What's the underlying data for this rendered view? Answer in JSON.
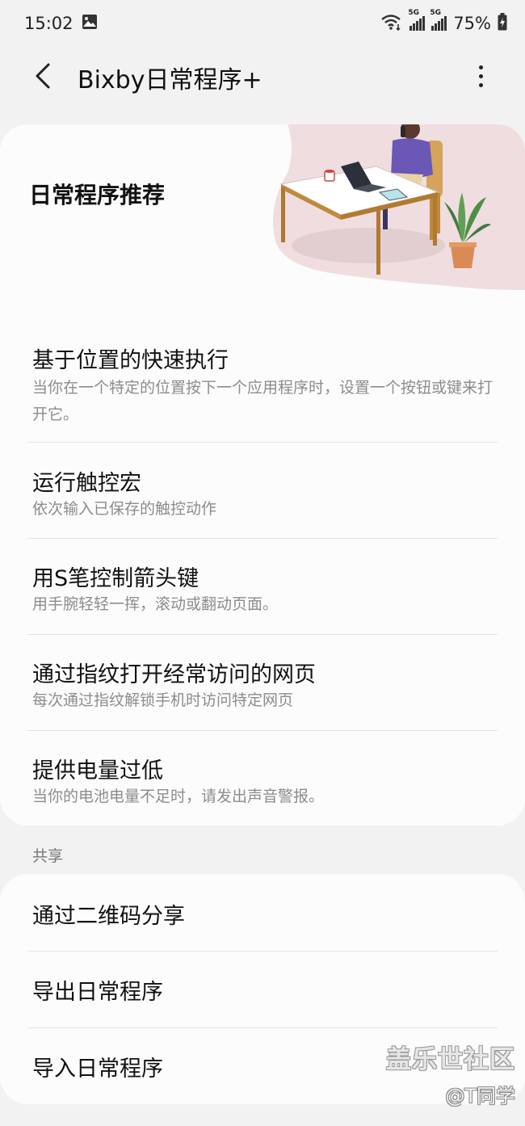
{
  "status_bar": {
    "time": "15:02",
    "left_icons": [
      "gallery-icon"
    ],
    "signal_label_1": "5G",
    "signal_label_2": "5G",
    "battery": "75%",
    "right_icons": [
      "wifi-icon",
      "signal-icon",
      "signal-icon",
      "battery-charging-icon"
    ]
  },
  "app_bar": {
    "title": "Bixby日常程序+",
    "back_icon": "back-arrow-icon",
    "more_icon": "more-vertical-icon"
  },
  "hero": {
    "title": "日常程序推荐",
    "illustration": "person-at-desk-with-plant-illustration"
  },
  "routines": [
    {
      "title": "基于位置的快速执行",
      "description": "当你在一个特定的位置按下一个应用程序时，设置一个按钮或键来打开它。"
    },
    {
      "title": "运行触控宏",
      "description": "依次输入已保存的触控动作"
    },
    {
      "title": "用S笔控制箭头键",
      "description": "用手腕轻轻一挥，滚动或翻动页面。"
    },
    {
      "title": "通过指纹打开经常访问的网页",
      "description": "每次通过指纹解锁手机时访问特定网页"
    },
    {
      "title": "提供电量过低",
      "description": "当你的电池电量不足时，请发出声音警报。"
    }
  ],
  "share_section": {
    "header": "共享",
    "items": [
      {
        "label": "通过二维码分享"
      },
      {
        "label": "导出日常程序"
      },
      {
        "label": "导入日常程序"
      }
    ]
  },
  "watermark": {
    "line1": "盖乐世社区",
    "line2": "@T同学"
  },
  "colors": {
    "background": "#f2f2f2",
    "card": "#fcfcfc",
    "text_primary": "#111111",
    "text_secondary": "#8c8c8c",
    "divider": "#e3e3e3",
    "illustration_pink": "#f0dde0"
  }
}
